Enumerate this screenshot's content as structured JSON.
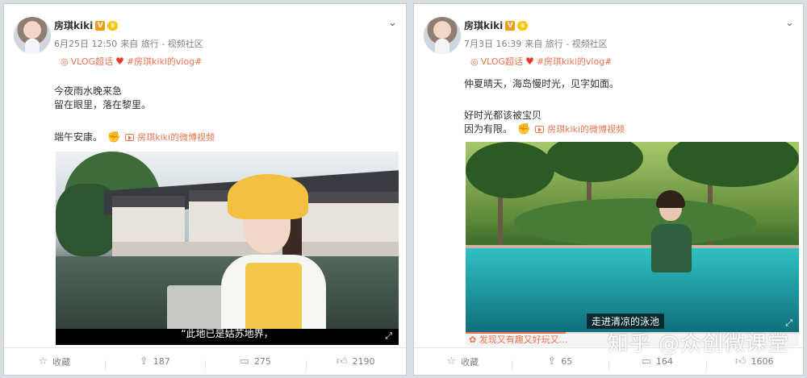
{
  "left": {
    "username": "房琪kiki",
    "v_badge": "V",
    "vip_icon": "vip",
    "date": "6月25日 12:50",
    "source": "来自 旅行 - 视频社区",
    "topic_label": "VLOG超话",
    "hashtag": "#房琪kiki的vlog#",
    "text_lines": [
      "今夜雨水晚来急",
      "留在眼里，落在黎里。"
    ],
    "greeting": "端午安康。",
    "video_link": "房琪kiki的微博视频",
    "subtitle": "“此地已是姑苏地界，",
    "footer": {
      "favorite": "收藏",
      "repost": "187",
      "comment": "275",
      "like": "2190"
    }
  },
  "right": {
    "username": "房琪kiki",
    "v_badge": "V",
    "vip_icon": "vip",
    "date": "7月3日 16:39",
    "source": "来自 旅行 - 视频社区",
    "topic_label": "VLOG超话",
    "hashtag": "#房琪kiki的vlog#",
    "text_lines": [
      "仲夏晴天，海岛慢时光，见字如面。"
    ],
    "text_lines2": [
      "好时光都该被宝贝",
      "因为有限。"
    ],
    "video_link": "房琪kiki的微博视频",
    "subtitle": "走进清凉的泳池",
    "progress": 0.3,
    "fire_text": "发现又有趣又好玩又...",
    "footer": {
      "favorite": "收藏",
      "repost": "65",
      "comment": "164",
      "like": "1606"
    }
  },
  "watermark": "知乎 @众创微课堂",
  "colors": {
    "accent": "#eb7350",
    "badge": "#f09b15",
    "heart": "#e8382b"
  },
  "icons": [
    "avatar",
    "v-badge-icon",
    "vip-icon",
    "chevron-down-icon",
    "topic-icon",
    "heart-icon",
    "hand-icon",
    "video-icon",
    "fullscreen-icon",
    "star-icon",
    "repost-icon",
    "comment-icon",
    "like-icon",
    "fire-icon"
  ]
}
